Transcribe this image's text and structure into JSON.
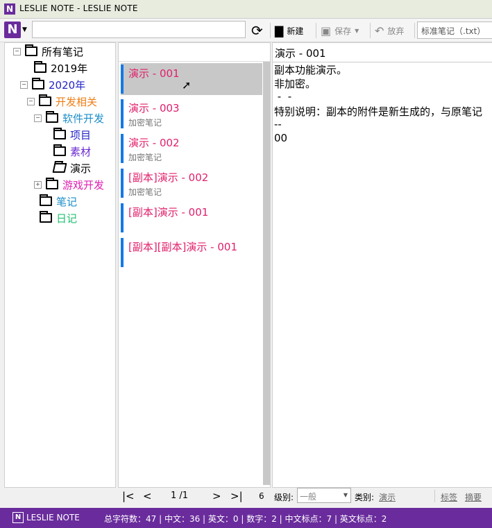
{
  "window": {
    "title": "LESLIE NOTE - LESLIE NOTE"
  },
  "toolbar": {
    "new_label": "新建",
    "save_label": "保存",
    "discard_label": "放弃",
    "note_type": "标准笔记（.txt）"
  },
  "tree": {
    "root": "所有笔记",
    "y2019": "2019年",
    "y2020": "2020年",
    "dev": "开发相关",
    "software": "软件开发",
    "project": "项目",
    "material": "素材",
    "demo": "演示",
    "game": "游戏开发",
    "notes": "笔记",
    "diary": "日记",
    "colors": {
      "y2020": "#2424c8",
      "dev": "#f07e14",
      "software": "#1c8ec8",
      "material": "#6a2cd0",
      "game": "#e020b0",
      "notes": "#1c8ec8",
      "diary": "#20c070",
      "project": "#2424c8"
    }
  },
  "notes_list": [
    {
      "title": "演示 - 001",
      "subtitle": ""
    },
    {
      "title": "演示 - 003",
      "subtitle": "加密笔记"
    },
    {
      "title": "演示 - 002",
      "subtitle": "加密笔记"
    },
    {
      "title": "[副本]演示 - 002",
      "subtitle": "加密笔记"
    },
    {
      "title": "[副本]演示 - 001",
      "subtitle": ""
    },
    {
      "title": "[副本][副本]演示 - 001",
      "subtitle": ""
    }
  ],
  "editor": {
    "title": "演示 - 001",
    "lines": [
      "副本功能演示。",
      "非加密。",
      " -  -",
      "特别说明：副本的附件是新生成的，与原笔记",
      "--",
      "00"
    ]
  },
  "pager": {
    "page": "1 /1",
    "count": "6"
  },
  "options": {
    "level_label": "级别:",
    "level_value": "一般",
    "category_label": "类别:",
    "category_value": "演示",
    "tags_link": "标签",
    "summary_link": "摘要"
  },
  "status": {
    "brand": "LESLIE NOTE",
    "stats": "总字符数：47 | 中文：36 | 英文：0 | 数字：2 | 中文标点：7 | 英文标点：2"
  }
}
